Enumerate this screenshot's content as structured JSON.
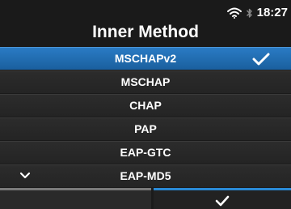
{
  "status_bar": {
    "time": "18:27",
    "icons": [
      "wifi-icon",
      "bluetooth-icon"
    ]
  },
  "header": {
    "title": "Inner Method"
  },
  "list": {
    "items": [
      {
        "label": "MSCHAPv2",
        "selected": true,
        "checked": true
      },
      {
        "label": "MSCHAP",
        "selected": false,
        "checked": false
      },
      {
        "label": "CHAP",
        "selected": false,
        "checked": false
      },
      {
        "label": "PAP",
        "selected": false,
        "checked": false
      },
      {
        "label": "EAP-GTC",
        "selected": false,
        "checked": false
      },
      {
        "label": "EAP-MD5",
        "selected": false,
        "checked": false
      }
    ],
    "scroll_indicator_icon": "chevron-down-icon"
  },
  "footer": {
    "left_button_icon": "none",
    "right_button_icon": "check-icon"
  },
  "colors": {
    "selected_row": "#2a7bc4",
    "accent_bar": "#2a8ad6",
    "background": "#1b1b1b",
    "text": "#ffffff"
  }
}
